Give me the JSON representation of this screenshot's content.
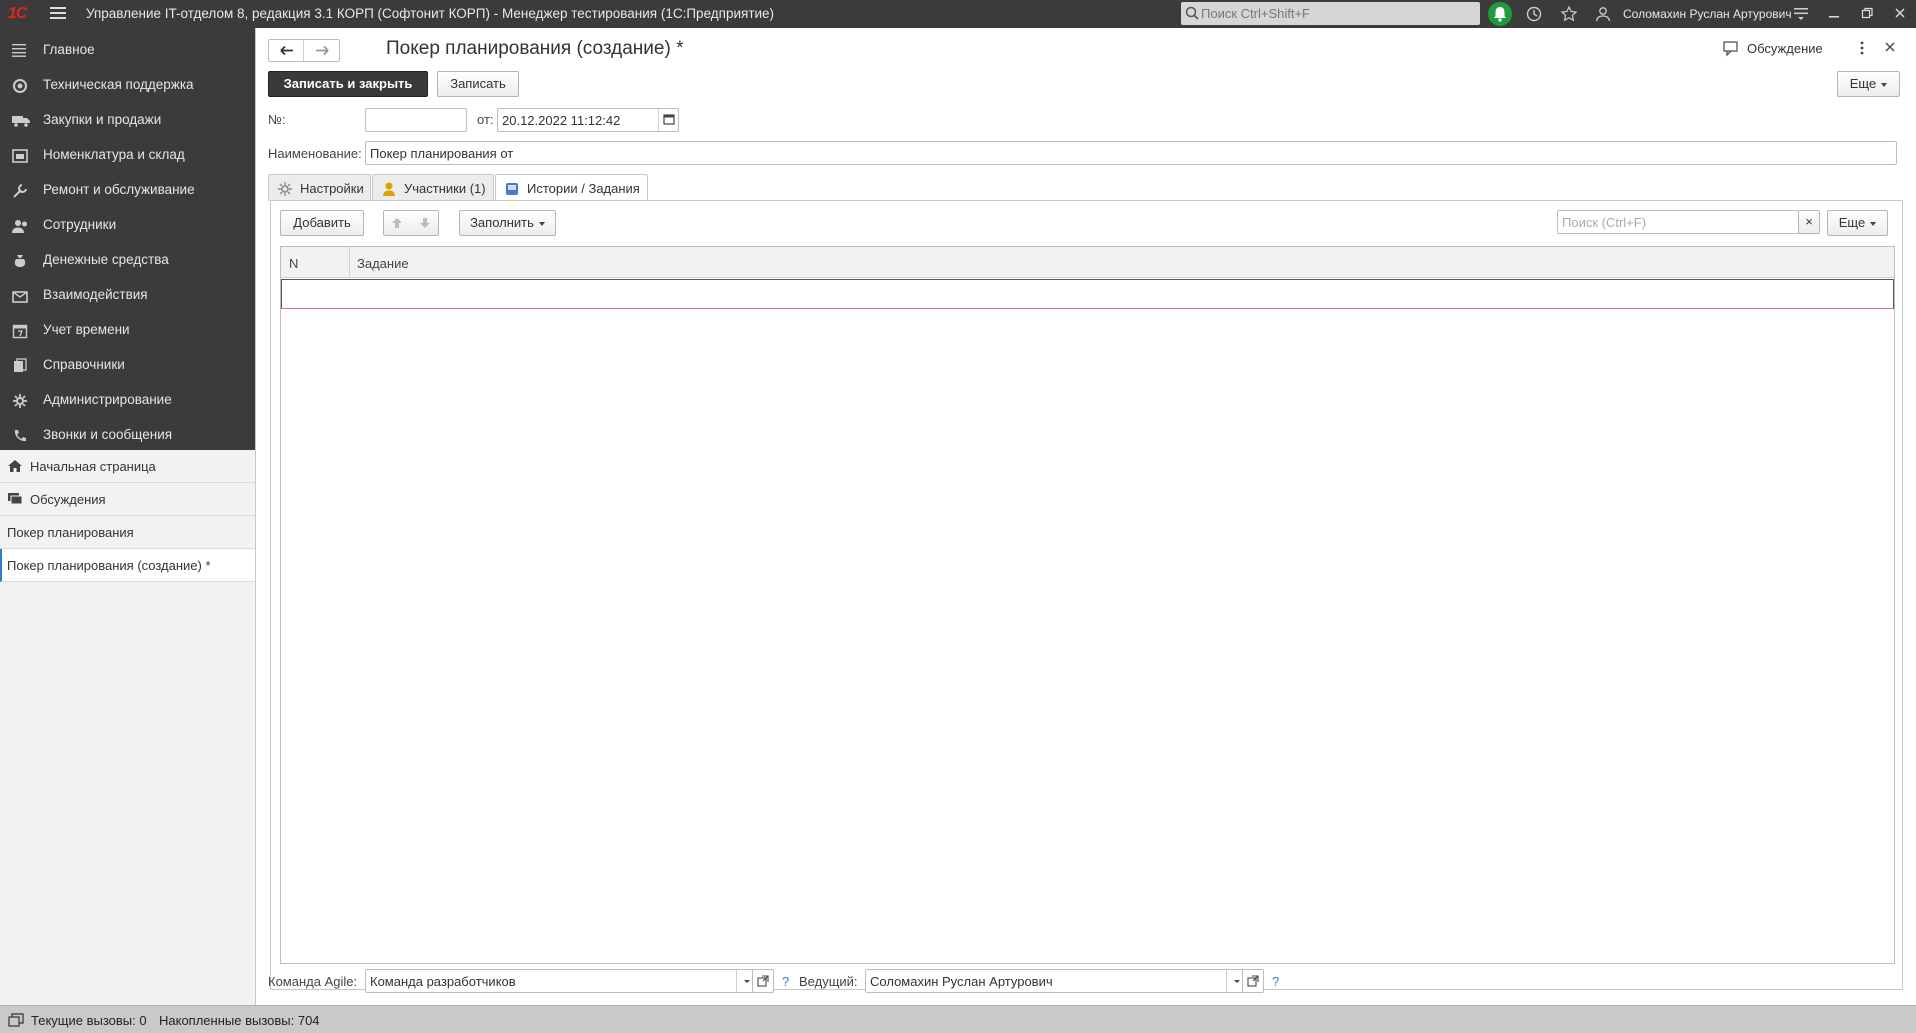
{
  "titlebar": {
    "logo": "1С",
    "title": "Управление IT-отделом 8, редакция 3.1 КОРП (Софтонит КОРП)  - Менеджер тестирования (1С:Предприятие)",
    "search_placeholder": "Поиск Ctrl+Shift+F",
    "user": "Соломахин Руслан Артурович",
    "icons": [
      "menu-icon",
      "search-icon",
      "bell-icon",
      "history-icon",
      "star-icon",
      "user-icon",
      "settings-icon",
      "minimize-icon",
      "restore-icon",
      "close-icon"
    ],
    "colors": {
      "bar": "#3b3b3b",
      "logo": "#e2231a",
      "bell": "#1e9b3c"
    }
  },
  "sidebar": {
    "sections": [
      {
        "label": "Главное",
        "icon": "list-icon"
      },
      {
        "label": "Техническая поддержка",
        "icon": "support-icon"
      },
      {
        "label": "Закупки и продажи",
        "icon": "truck-icon"
      },
      {
        "label": "Номенклатура и склад",
        "icon": "warehouse-icon"
      },
      {
        "label": "Ремонт и обслуживание",
        "icon": "wrench-icon"
      },
      {
        "label": "Сотрудники",
        "icon": "people-icon"
      },
      {
        "label": "Денежные средства",
        "icon": "money-icon"
      },
      {
        "label": "Взаимодействия",
        "icon": "mail-icon"
      },
      {
        "label": "Учет времени",
        "icon": "calendar-icon"
      },
      {
        "label": "Справочники",
        "icon": "books-icon"
      },
      {
        "label": "Администрирование",
        "icon": "gear-icon"
      },
      {
        "label": "Звонки и сообщения",
        "icon": "phone-icon"
      }
    ],
    "open": [
      {
        "label": "Начальная страница",
        "icon": "home-icon"
      },
      {
        "label": "Обсуждения",
        "icon": "chat-icon"
      },
      {
        "label": "Покер планирования"
      },
      {
        "label": "Покер планирования (создание) *",
        "active": true
      }
    ]
  },
  "form": {
    "title": "Покер планирования (создание) *",
    "discussion": "Обсуждение",
    "buttons": {
      "save_close": "Записать и закрыть",
      "save": "Записать",
      "more": "Еще"
    },
    "number_label": "№:",
    "number_value": "",
    "date_label": "от:",
    "date_value": "20.12.2022 11:12:42",
    "name_label": "Наименование:",
    "name_value": "Покер планирования от",
    "tabs": [
      {
        "label": "Настройки",
        "icon": "gear-icon"
      },
      {
        "label": "Участники (1)",
        "icon": "user-icon"
      },
      {
        "label": "Истории / Задания",
        "icon": "stories-icon",
        "active": true
      }
    ],
    "toolbar": {
      "add": "Добавить",
      "fill": "Заполнить",
      "search_placeholder": "Поиск (Ctrl+F)",
      "clear": "×",
      "more": "Еще"
    },
    "grid": {
      "columns": [
        "N",
        "Задание"
      ],
      "rows": []
    },
    "team_label": "Команда Agile:",
    "team_value": "Команда разработчиков",
    "lead_label": "Ведущий:",
    "lead_value": "Соломахин Руслан Артурович",
    "help": "?"
  },
  "status": {
    "current_calls": "Текущие вызовы: 0",
    "accumulated_calls": "Накопленные вызовы: 704"
  }
}
